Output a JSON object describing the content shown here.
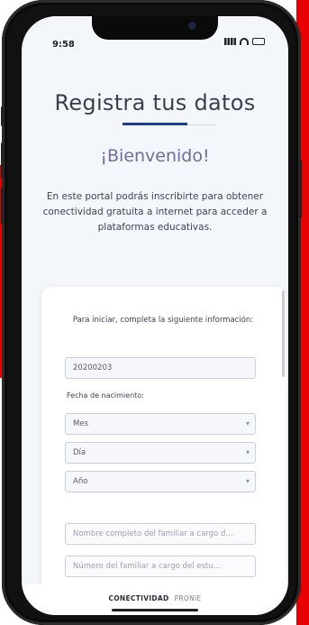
{
  "status_bar": {
    "time": "9:58"
  },
  "page": {
    "title": "Registra tus datos",
    "welcome": "¡Bienvenido!",
    "intro": "En este portal podrás inscribirte para obtener conectividad gratuita a internet para acceder a plataformas educativas."
  },
  "form": {
    "intro": "Para iniciar, completa la siguiente información:",
    "id_value": "20200203",
    "birth_label": "Fecha de nacimiento:",
    "month_select": "Mes",
    "day_select": "Día",
    "year_select": "Año",
    "guardian_name_placeholder": "Nombre completo del familiar a cargo d…",
    "guardian_number_placeholder": "Número del familiar a cargo del estu…"
  },
  "footer": {
    "primary": "CONECTIVIDAD",
    "secondary": "PRONIE"
  }
}
